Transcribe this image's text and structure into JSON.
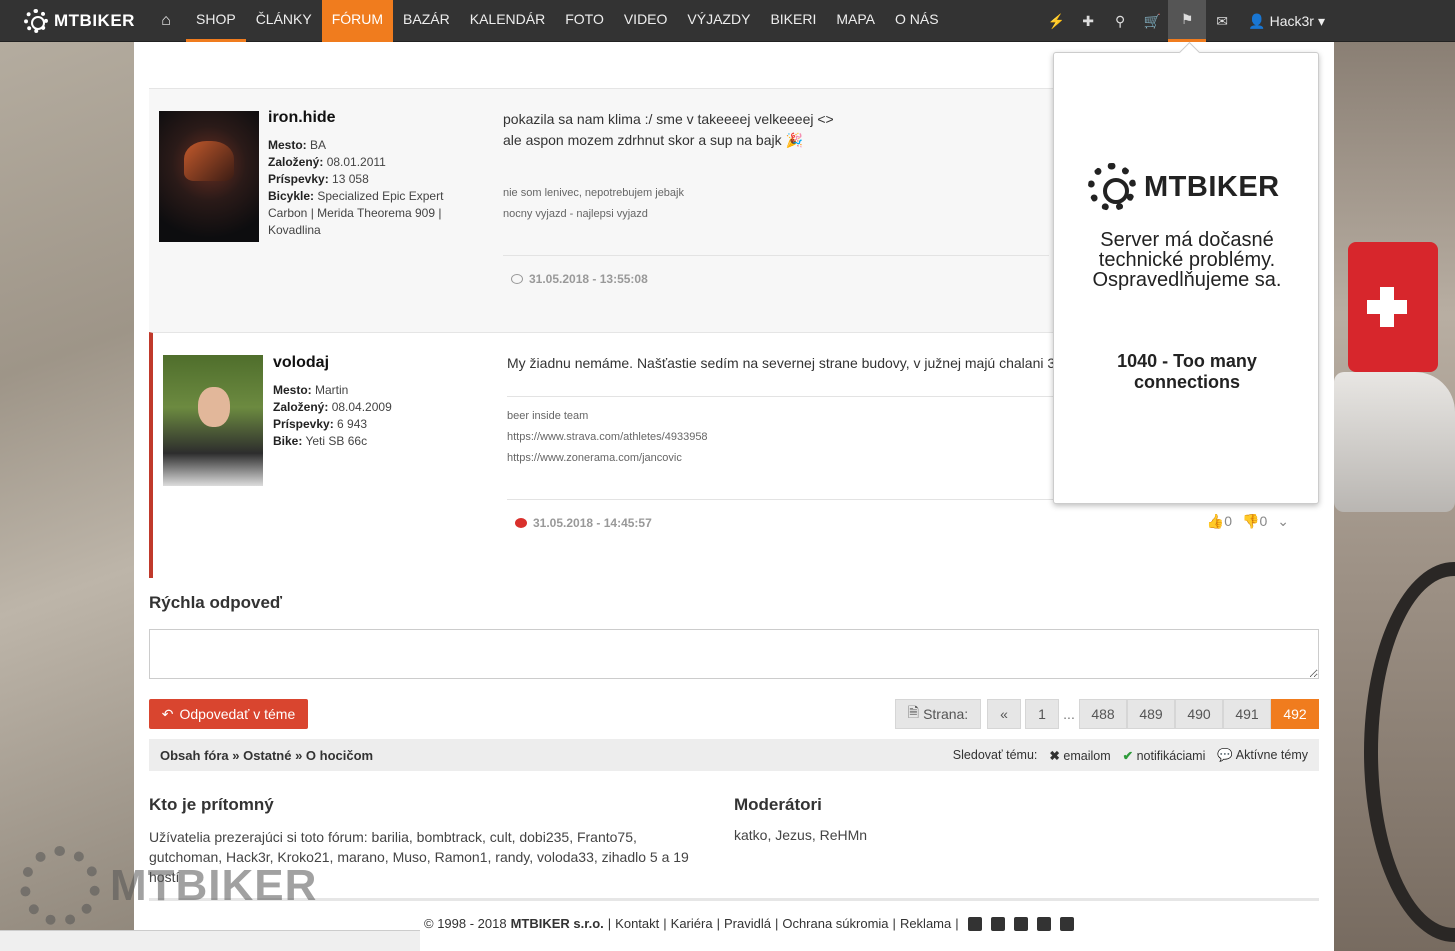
{
  "nav": {
    "logo": "MTBIKER",
    "items": [
      "SHOP",
      "ČLÁNKY",
      "FÓRUM",
      "BAZÁR",
      "KALENDÁR",
      "FOTO",
      "VIDEO",
      "VÝJAZDY",
      "BIKERI",
      "MAPA",
      "O NÁS"
    ],
    "user": "Hack3r"
  },
  "posts": [
    {
      "username": "iron.hide",
      "info": [
        {
          "label": "Mesto:",
          "value": "BA"
        },
        {
          "label": "Založený:",
          "value": "08.01.2011"
        },
        {
          "label": "Príspevky:",
          "value": "13 058"
        },
        {
          "label": "Bicykle:",
          "value": "Specialized Epic Expert Carbon | Merida Theorema 909 | Kovadlina"
        }
      ],
      "text1": "pokazila sa nam klima :/ sme v takeeeej velkeeeej <>",
      "text2": "ale aspon mozem zdrhnut skor a sup na bajk",
      "sig1": "nie som lenivec, nepotrebujem jebajk",
      "sig2": "nocny vyjazd - najlepsi vyjazd",
      "date": "31.05.2018 - 13:55:08"
    },
    {
      "username": "volodaj",
      "info": [
        {
          "label": "Mesto:",
          "value": "Martin"
        },
        {
          "label": "Založený:",
          "value": "08.04.2009"
        },
        {
          "label": "Príspevky:",
          "value": "6 943"
        },
        {
          "label": "Bike:",
          "value": "Yeti SB 66c"
        }
      ],
      "text1": "My žiadnu nemáme. Našťastie sedím na severnej strane budovy, v južnej majú chalani 3",
      "sig1": "beer inside team",
      "sig2": "https://www.strava.com/athletes/4933958",
      "sig3": "https://www.zonerama.com/jancovic",
      "date": "31.05.2018 - 14:45:57",
      "likes": "0",
      "dislikes": "0"
    }
  ],
  "quick_reply": {
    "title": "Rýchla odpoveď"
  },
  "reply_button": "Odpovedať v téme",
  "pager": {
    "label": "Strana:",
    "prev": "«",
    "first": "1",
    "dots": "...",
    "pages": [
      "488",
      "489",
      "490",
      "491"
    ],
    "current": "492"
  },
  "breadcrumb": {
    "text": "Obsah fóra » Ostatné » O hocičom"
  },
  "follow": {
    "label": "Sledovať tému:",
    "email": "emailom",
    "notif": "notifikáciami",
    "active": "Aktívne témy"
  },
  "who": {
    "title": "Kto je prítomný",
    "text": "Užívatelia prezerajúci si toto fórum: barilia, bombtrack, cult, dobi235, Franto75, gutchoman, Hack3r, Kroko21, marano, Muso, Ramon1, randy, voloda33, zihadlo 5 a 19 hostí"
  },
  "moderators": {
    "title": "Moderátori",
    "text": "katko, Jezus, ReHMn"
  },
  "footer": {
    "copy": "© 1998 - 2018",
    "company": "MTBIKER s.r.o.",
    "links": [
      "Kontakt",
      "Kariéra",
      "Pravidlá",
      "Ochrana súkromia",
      "Reklama"
    ]
  },
  "popup": {
    "logo": "MTBIKER",
    "message": "Server má dočasné technické problémy. Ospravedlňujeme sa.",
    "error": "1040 - Too many connections"
  },
  "watermark": "MTBIKER",
  "colors": {
    "accent": "#f07c1e",
    "reply": "#d9452f",
    "nav_bg": "#333333"
  }
}
